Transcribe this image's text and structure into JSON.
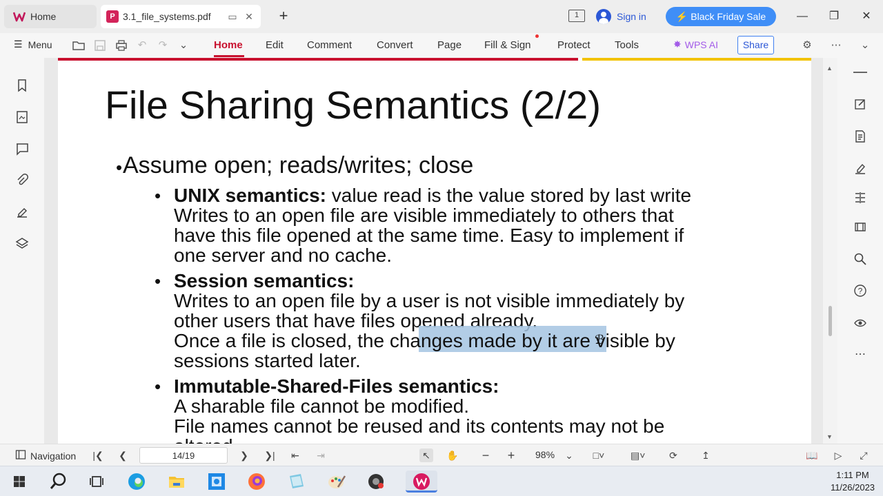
{
  "tabs": [
    {
      "label": "Home"
    },
    {
      "label": "3.1_file_systems.pdf"
    }
  ],
  "titlebar": {
    "page_indicator": "1",
    "signin_label": "Sign in",
    "promo_label": "Black Friday Sale"
  },
  "menubar": {
    "menu_label": "Menu",
    "items": [
      "Home",
      "Edit",
      "Comment",
      "Convert",
      "Page",
      "Fill & Sign",
      "Protect",
      "Tools"
    ],
    "active_item": "Home",
    "wps_ai_label": "WPS AI",
    "share_label": "Share"
  },
  "slide": {
    "title": "File Sharing Semantics (2/2)",
    "lines": [
      "Assume open; reads/writes; close",
      "UNIX semantics:",
      " value read is the value stored by last write",
      "Writes to an open file are visible immediately to others that",
      "have this file opened at the same time.  Easy to implement if",
      "one server and no cache.",
      "Session semantics:",
      "Writes to an open file by a user is not visible immediately by",
      "other users that have files opened already.",
      "Once a file is closed, the changes made by it are visible by",
      "sessions started later.",
      "Immutable-Shared-Files semantics:",
      "A sharable file cannot be modified.",
      "File names cannot be reused and its contents may not be",
      "altered."
    ],
    "highlighted_text": "hanges made by it a"
  },
  "statusbar": {
    "navigation_label": "Navigation",
    "page_field": "14/19",
    "zoom": "98%"
  },
  "clock": {
    "time": "1:11 PM",
    "date": "11/26/2023"
  },
  "colors": {
    "accent_red": "#c8102e",
    "brand_blue": "#3f8ef7",
    "highlight": "#a5c4e2"
  }
}
